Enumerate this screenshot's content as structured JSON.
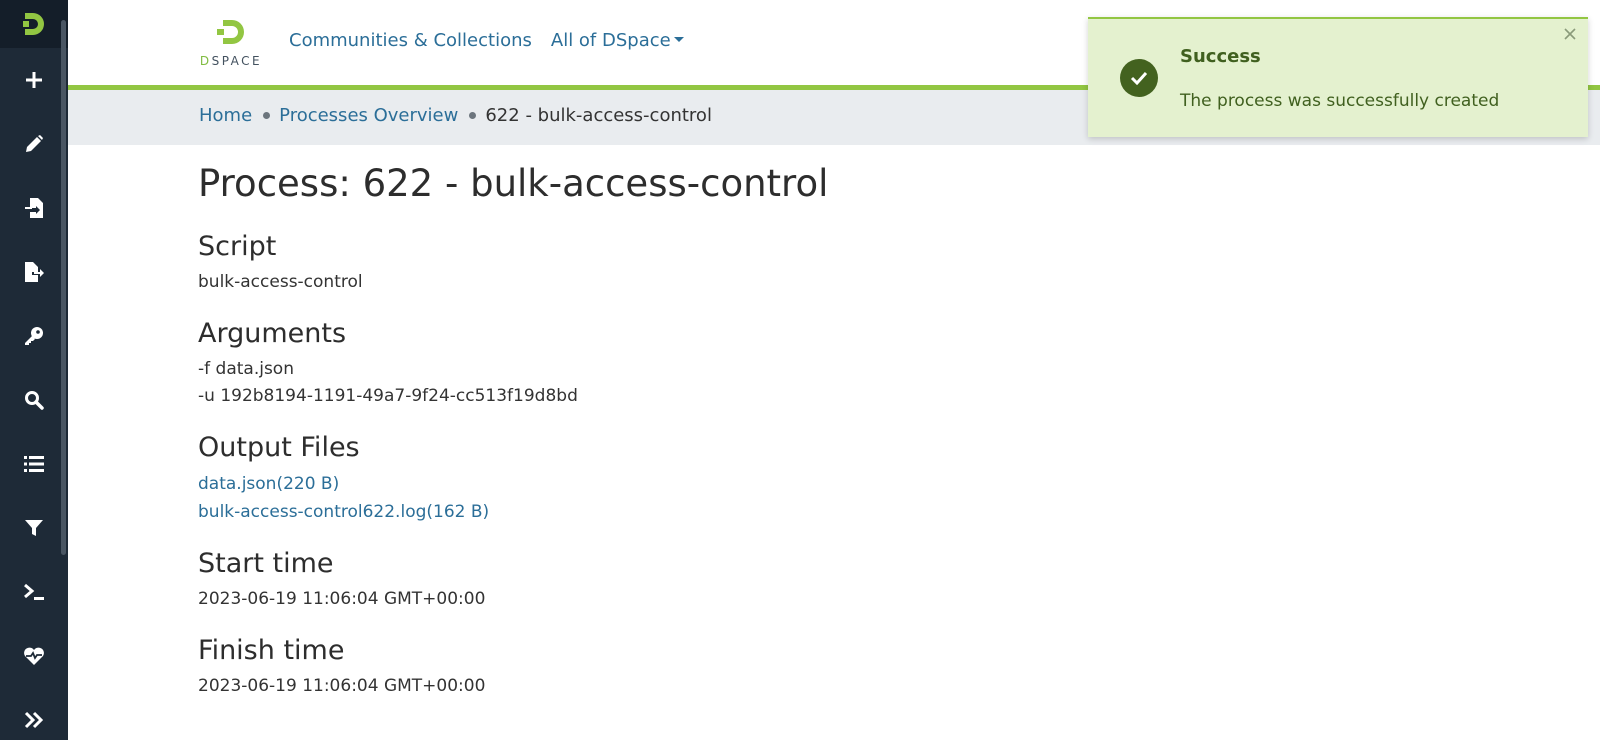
{
  "header": {
    "brand_d": "D",
    "brand_rest": "SPACE",
    "nav": [
      {
        "label": "Communities & Collections"
      },
      {
        "label": "All of DSpace"
      }
    ]
  },
  "sidebar": {
    "items": [
      {
        "icon": "plus-icon"
      },
      {
        "icon": "pencil-icon"
      },
      {
        "icon": "file-import-icon"
      },
      {
        "icon": "file-export-icon"
      },
      {
        "icon": "key-icon"
      },
      {
        "icon": "search-icon"
      },
      {
        "icon": "list-icon"
      },
      {
        "icon": "filter-icon"
      },
      {
        "icon": "terminal-icon"
      },
      {
        "icon": "heartbeat-icon"
      },
      {
        "icon": "double-chevron-right-icon"
      }
    ]
  },
  "breadcrumb": {
    "home": "Home",
    "processes": "Processes Overview",
    "current": "622 - bulk-access-control"
  },
  "page": {
    "title": "Process: 622 - bulk-access-control",
    "script_heading": "Script",
    "script_value": "bulk-access-control",
    "arguments_heading": "Arguments",
    "arguments": [
      "-f data.json",
      "-u 192b8194-1191-49a7-9f24-cc513f19d8bd"
    ],
    "output_heading": "Output Files",
    "output_files": [
      "data.json(220 B)",
      "bulk-access-control622.log(162 B)"
    ],
    "start_heading": "Start time",
    "start_value": "2023-06-19 11:06:04 GMT+00:00",
    "finish_heading": "Finish time",
    "finish_value": "2023-06-19 11:06:04 GMT+00:00"
  },
  "toast": {
    "title": "Success",
    "message": "The process was successfully created"
  },
  "colors": {
    "sidebar": "#1e2a37",
    "accent_green": "#92c642",
    "link": "#2b6e98",
    "toast_bg": "#e4f1cf"
  }
}
